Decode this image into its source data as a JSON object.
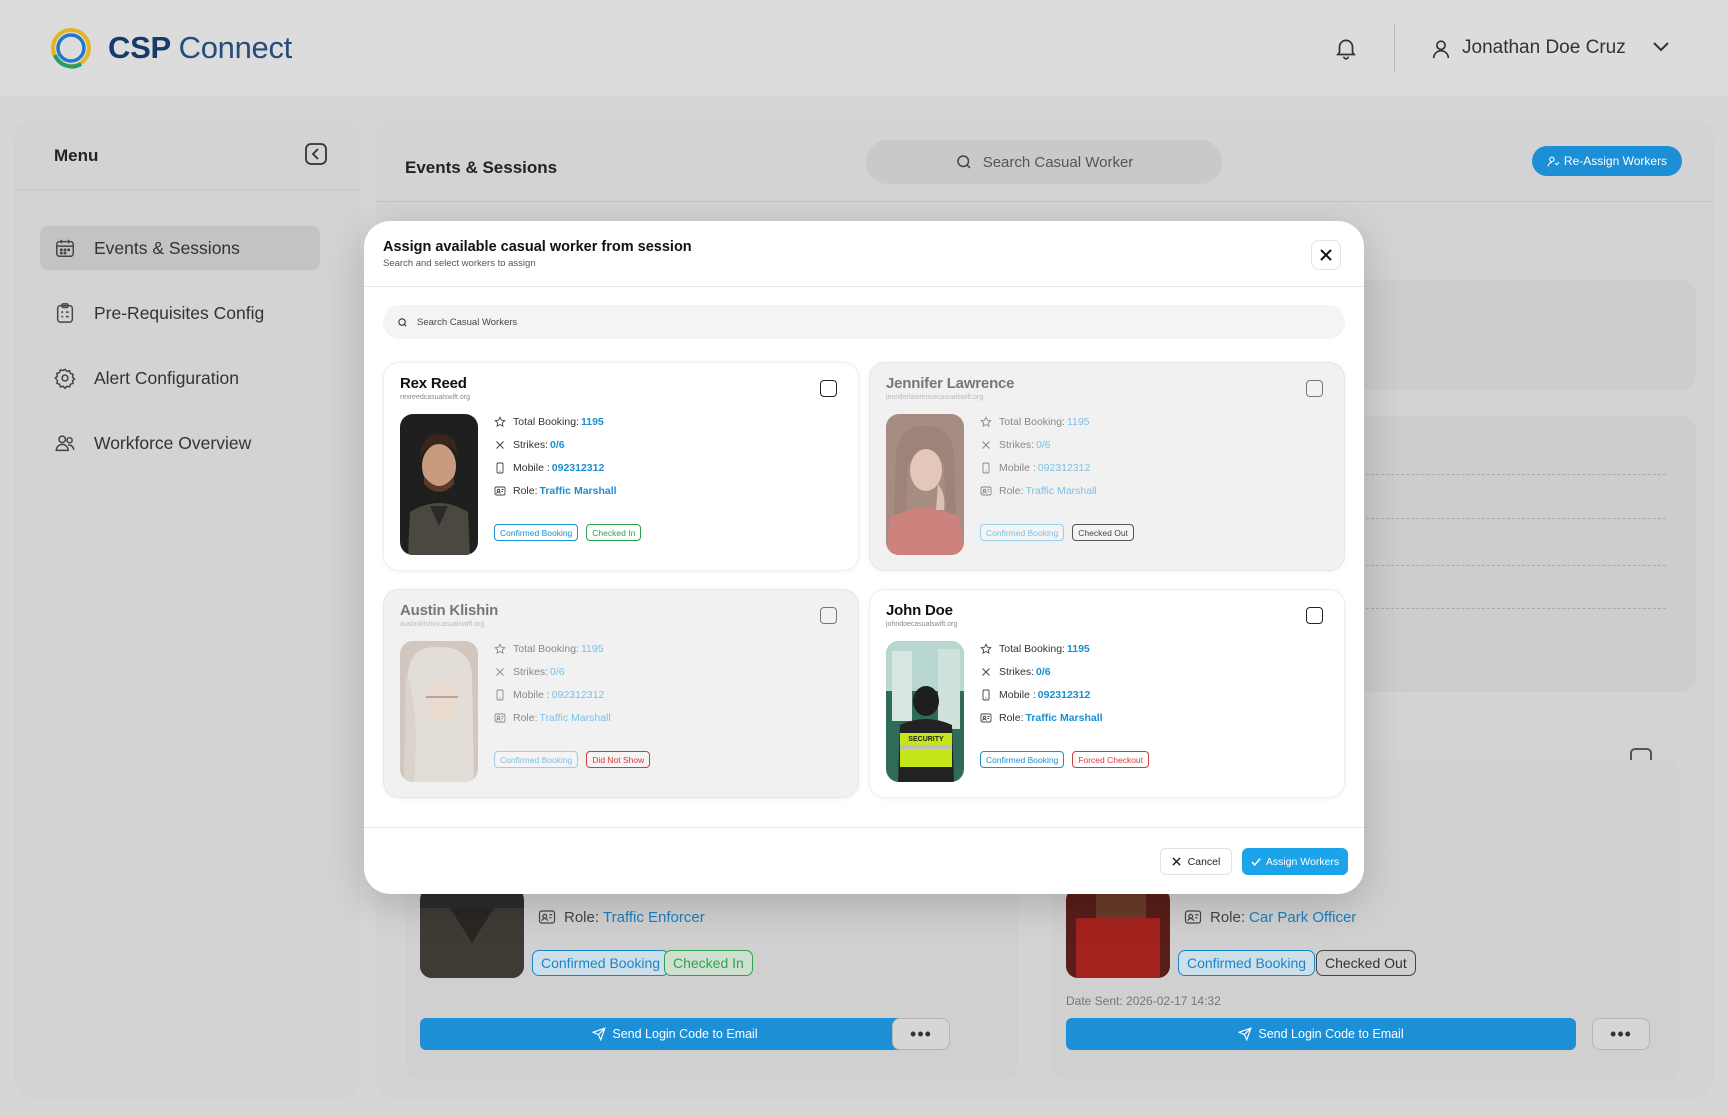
{
  "app": {
    "name_part1": "CSP",
    "name_part2": "Connect"
  },
  "header": {
    "username": "Jonathan Doe Cruz"
  },
  "sidebar": {
    "title": "Menu",
    "items": [
      {
        "label": "Events & Sessions",
        "icon": "calendar-icon",
        "active": true
      },
      {
        "label": "Pre-Requisites Config",
        "icon": "clipboard-icon",
        "active": false
      },
      {
        "label": "Alert Configuration",
        "icon": "gear-icon",
        "active": false
      },
      {
        "label": "Workforce Overview",
        "icon": "users-icon",
        "active": false
      }
    ]
  },
  "main": {
    "title": "Events & Sessions",
    "search_placeholder": "Search Casual Worker",
    "reassign_label": "Re-Assign Workers",
    "bg_cards": [
      {
        "role_label": "Role:",
        "role": "Traffic Enforcer",
        "tags": [
          "Confirmed Booking",
          "Checked In"
        ],
        "send_label": "Send Login Code to Email"
      },
      {
        "role_label": "Role:",
        "role": "Car Park Officer",
        "tags": [
          "Confirmed Booking",
          "Checked Out"
        ],
        "date_sent": "Date Sent: 2026-02-17 14:32",
        "send_label": "Send Login Code to Email"
      }
    ]
  },
  "modal": {
    "title": "Assign available casual worker from session",
    "subtitle": "Search and select workers to assign",
    "search_placeholder": "Search Casual Workers",
    "labels": {
      "total": "Total Booking:",
      "strikes": "Strikes:",
      "mobile": "Mobile :",
      "role": "Role:"
    },
    "workers": [
      {
        "name": "Rex Reed",
        "email": "rexreedcasualswift.org",
        "total_booking": "1195",
        "strikes": "0/6",
        "mobile": "092312312",
        "role": "Traffic Marshall",
        "tags": [
          {
            "text": "Confirmed Booking",
            "color": "blue"
          },
          {
            "text": "Checked In",
            "color": "green"
          }
        ],
        "available": true
      },
      {
        "name": "Jennifer Lawrence",
        "email": "jenniferlawrencecasualswift.org",
        "total_booking": "1195",
        "strikes": "0/6",
        "mobile": "092312312",
        "role": "Traffic Marshall",
        "tags": [
          {
            "text": "Confirmed Booking",
            "color": "blue"
          },
          {
            "text": "Checked Out",
            "color": "gray"
          }
        ],
        "available": false
      },
      {
        "name": "Austin Klishin",
        "email": "austinklishincasualswift.org",
        "total_booking": "1195",
        "strikes": "0/6",
        "mobile": "092312312",
        "role": "Traffic Marshall",
        "tags": [
          {
            "text": "Confirmed Booking",
            "color": "blue"
          },
          {
            "text": "Did Not Show",
            "color": "red"
          }
        ],
        "available": false
      },
      {
        "name": "John Doe",
        "email": "johndoecasualswift.org",
        "total_booking": "1195",
        "strikes": "0/6",
        "mobile": "092312312",
        "role": "Traffic Marshall",
        "tags": [
          {
            "text": "Confirmed Booking",
            "color": "blue"
          },
          {
            "text": "Forced Checkout",
            "color": "red"
          }
        ],
        "available": true
      }
    ],
    "cancel_label": "Cancel",
    "assign_label": "Assign Workers"
  },
  "colors": {
    "accent": "#1d8fd6",
    "brand": "#183a6b",
    "success": "#29a245",
    "danger": "#d43a3a"
  }
}
